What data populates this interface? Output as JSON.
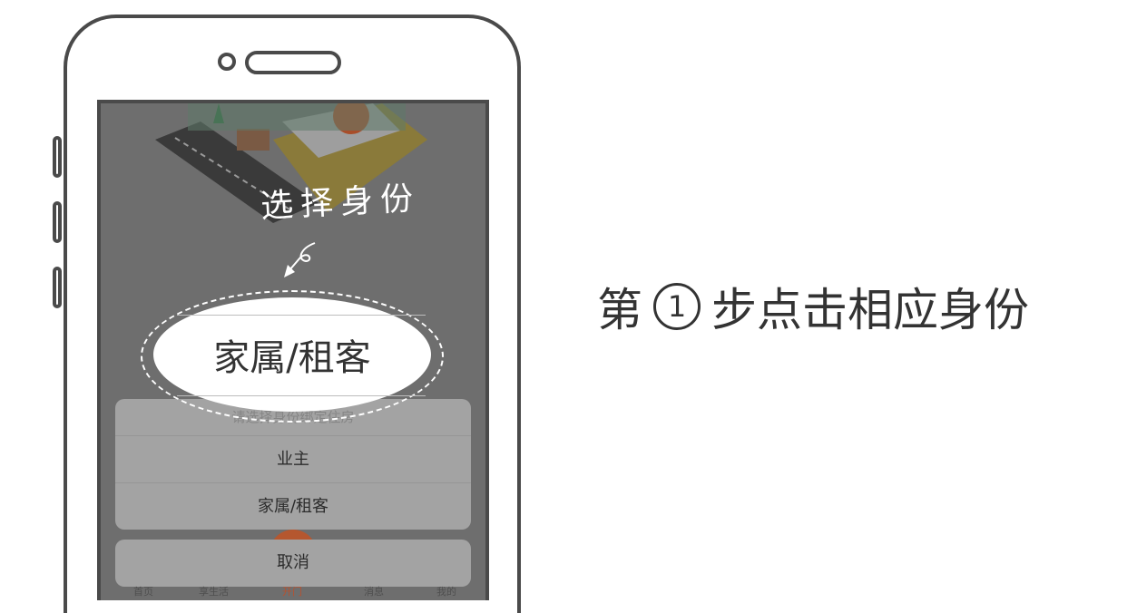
{
  "screen": {
    "handwritten_title": "选择身份",
    "sheet": {
      "title": "请选择身份绑定住房",
      "options": [
        "业主",
        "家属/租客"
      ],
      "cancel": "取消"
    },
    "tabbar": [
      "首页",
      "享生活",
      "开门",
      "消息",
      "我的"
    ]
  },
  "highlight": {
    "label": "家属/租客"
  },
  "caption": {
    "prefix": "第",
    "step": "1",
    "text": "步点击相应身份"
  },
  "colors": {
    "outline": "#4a4a4a",
    "overlay": "#6e6e6e",
    "sheet": "#a3a3a3",
    "accent": "#b5572f"
  }
}
